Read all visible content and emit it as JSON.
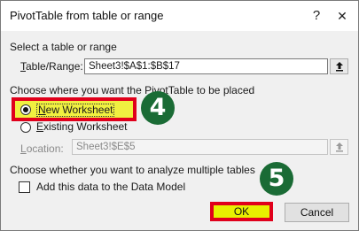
{
  "dialog": {
    "title": "PivotTable from table or range",
    "help_glyph": "?",
    "close_glyph": "✕"
  },
  "select_range": {
    "heading": "Select a table or range",
    "label_ul": "T",
    "label_rest": "able/Range:",
    "value": "Sheet3!$A$1:$B$17"
  },
  "placement": {
    "heading": "Choose where you want the PivotTable to be placed",
    "options": [
      {
        "label_ul": "N",
        "label_rest": "ew Worksheet",
        "selected": true
      },
      {
        "label_ul": "E",
        "label_rest": "xisting Worksheet",
        "selected": false
      }
    ],
    "location_label_ul": "L",
    "location_label_rest": "ocation:",
    "location_value": "Sheet3!$E$5"
  },
  "multiple_tables": {
    "heading": "Choose whether you want to analyze multiple tables",
    "checkbox_label": "Add this data to the Data Model",
    "checked": false
  },
  "buttons": {
    "ok": "OK",
    "cancel": "Cancel"
  },
  "annotations": {
    "step4": "4",
    "step5": "5",
    "badge_color": "#1a6b35",
    "highlight_border": "#e0001b",
    "highlight_fill": "#f0f040"
  },
  "icons": [
    "help-icon",
    "close-icon",
    "collapse-dialog-icon"
  ]
}
